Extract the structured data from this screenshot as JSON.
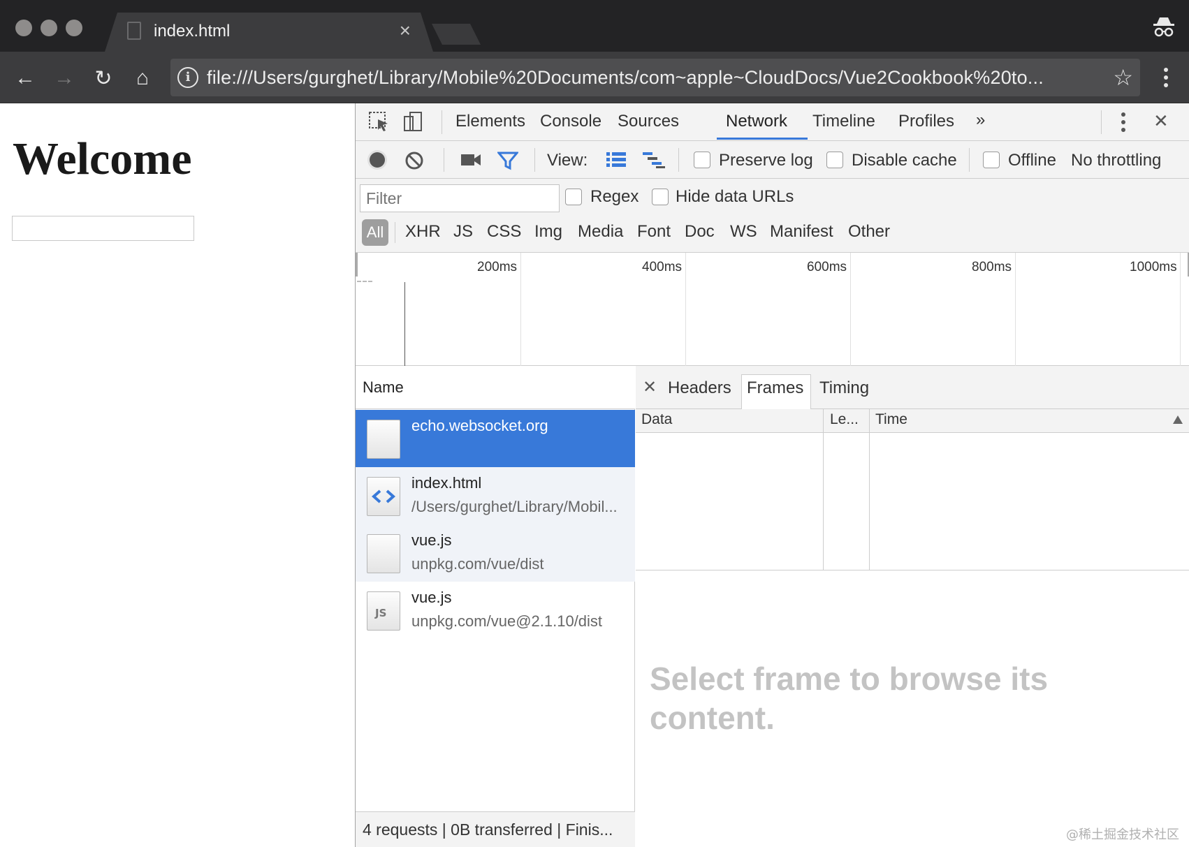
{
  "browser": {
    "tab_title": "index.html",
    "tab_close": "×",
    "url": "file:///Users/gurghet/Library/Mobile%20Documents/com~apple~CloudDocs/Vue2Cookbook%20to...",
    "info_glyph": "i",
    "star_glyph": "☆",
    "back_glyph": "←",
    "forward_glyph": "→",
    "reload_glyph": "↻",
    "home_glyph": "⌂"
  },
  "page": {
    "heading": "Welcome",
    "input_value": ""
  },
  "devtools": {
    "tabs": [
      "Elements",
      "Console",
      "Sources",
      "Network",
      "Timeline",
      "Profiles"
    ],
    "active_tab": "Network",
    "more_tabs_glyph": "»",
    "close_glyph": "✕",
    "toolbar": {
      "view_label": "View:",
      "preserve_log": "Preserve log",
      "disable_cache": "Disable cache",
      "offline": "Offline",
      "throttling": "No throttling"
    },
    "filter": {
      "placeholder": "Filter",
      "regex": "Regex",
      "hide_data_urls": "Hide data URLs"
    },
    "types": [
      "All",
      "XHR",
      "JS",
      "CSS",
      "Img",
      "Media",
      "Font",
      "Doc",
      "WS",
      "Manifest",
      "Other"
    ],
    "active_type": "All",
    "overview_ticks": [
      "200ms",
      "400ms",
      "600ms",
      "800ms",
      "1000ms"
    ],
    "name_header": "Name",
    "requests": [
      {
        "name": "echo.websocket.org",
        "path": "",
        "icon": "blank-file-icon",
        "selected": true
      },
      {
        "name": "index.html",
        "path": "/Users/gurghet/Library/Mobil...",
        "icon": "html-file-icon",
        "selected": false
      },
      {
        "name": "vue.js",
        "path": "unpkg.com/vue/dist",
        "icon": "blank-file-icon",
        "selected": false
      },
      {
        "name": "vue.js",
        "path": "unpkg.com/vue@2.1.10/dist",
        "icon": "js-file-icon",
        "selected": false
      }
    ],
    "status": "4 requests | 0B transferred | Finis...",
    "detail": {
      "close_glyph": "✕",
      "tabs": [
        "Headers",
        "Frames",
        "Timing"
      ],
      "active_tab": "Frames",
      "columns": [
        "Data",
        "Le...",
        "Time"
      ],
      "empty_message": "Select frame to browse its content."
    },
    "accent_color": "#3879d9"
  },
  "watermark": "@稀土掘金技术社区"
}
